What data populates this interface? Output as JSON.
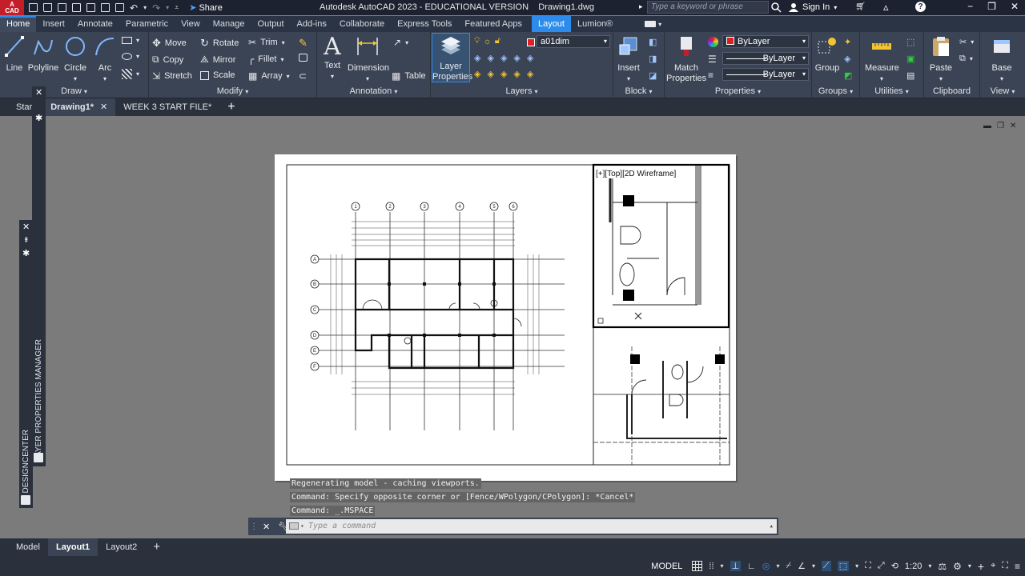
{
  "app": {
    "logo_text": "A\nCAD",
    "title": "Autodesk AutoCAD 2023 - EDUCATIONAL VERSION",
    "document": "Drawing1.dwg",
    "share_label": "Share",
    "search_placeholder": "Type a keyword or phrase",
    "sign_in": "Sign In"
  },
  "ribbon_tabs": [
    "Home",
    "Insert",
    "Annotate",
    "Parametric",
    "View",
    "Manage",
    "Output",
    "Add-ins",
    "Collaborate",
    "Express Tools",
    "Featured Apps",
    "Layout",
    "Lumion®"
  ],
  "ribbon": {
    "draw": {
      "label": "Draw",
      "line": "Line",
      "polyline": "Polyline",
      "circle": "Circle",
      "arc": "Arc"
    },
    "modify": {
      "label": "Modify",
      "move": "Move",
      "rotate": "Rotate",
      "trim": "Trim",
      "copy": "Copy",
      "mirror": "Mirror",
      "fillet": "Fillet",
      "stretch": "Stretch",
      "scale": "Scale",
      "array": "Array"
    },
    "annotation": {
      "label": "Annotation",
      "text": "Text",
      "dimension": "Dimension",
      "table": "Table"
    },
    "layers": {
      "label": "Layers",
      "layer_properties": "Layer\nProperties",
      "current_layer": "a01dim"
    },
    "block": {
      "label": "Block",
      "insert": "Insert"
    },
    "properties": {
      "label": "Properties",
      "match": "Match\nProperties",
      "color": "ByLayer",
      "linetype": "ByLayer",
      "lineweight": "ByLayer"
    },
    "groups": {
      "label": "Groups",
      "group": "Group"
    },
    "utilities": {
      "label": "Utilities",
      "measure": "Measure"
    },
    "clipboard": {
      "label": "Clipboard",
      "paste": "Paste"
    },
    "view": {
      "label": "View",
      "base": "Base"
    },
    "accent_color": "#2d8ceb",
    "layer_color": "#e02020"
  },
  "doc_tabs": [
    {
      "label": "Start"
    },
    {
      "label": "Drawing1*"
    },
    {
      "label": "WEEK 3 START FILE*"
    }
  ],
  "palettes": {
    "layer_manager": "LAYER PROPERTIES MANAGER",
    "designcenter": "DESIGNCENTER"
  },
  "viewport": {
    "label": "[+][Top][2D Wireframe]"
  },
  "grid_labels": {
    "columns": [
      "1",
      "2",
      "3",
      "4",
      "5",
      "6"
    ],
    "rows": [
      "A",
      "B",
      "C",
      "D",
      "E",
      "F"
    ]
  },
  "command_history": [
    "Regenerating model - caching viewports.",
    "Command: Specify opposite corner or [Fence/WPolygon/CPolygon]: *Cancel*",
    "Command: _.MSPACE"
  ],
  "command_placeholder": "Type a command",
  "layout_tabs": [
    "Model",
    "Layout1",
    "Layout2"
  ],
  "status": {
    "space": "MODEL",
    "scale": "1:20"
  }
}
